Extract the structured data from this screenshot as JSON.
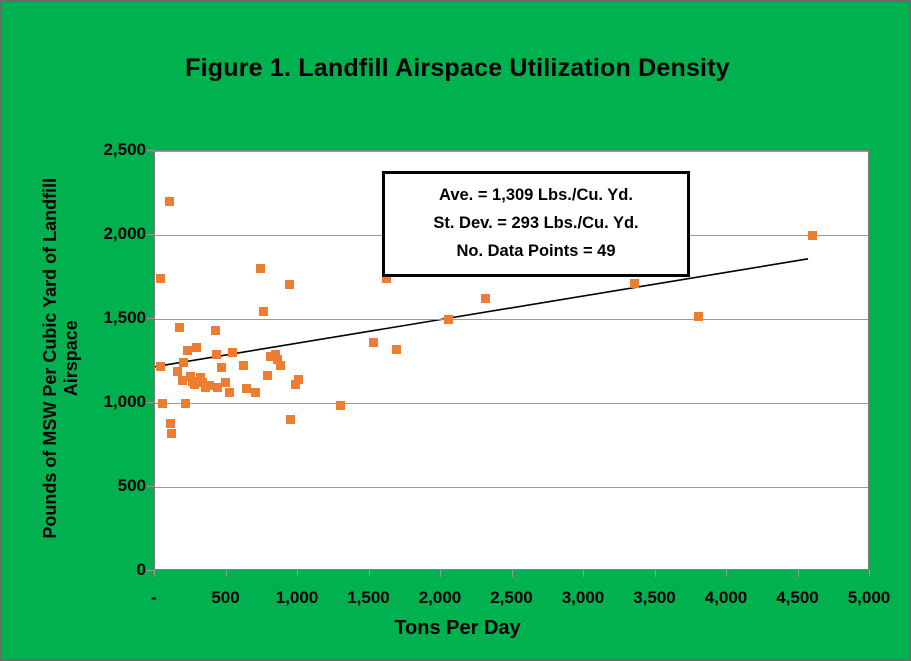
{
  "figure": {
    "background_color": "#00B14F",
    "border_color": "#6b6b6b",
    "title": "Figure 1. Landfill Airspace Utilization Density"
  },
  "axes": {
    "x_title": "Tons Per Day",
    "y_title_line1": "Pounds of MSW Per Cubic Yard of Landfill",
    "y_title_line2": "Airspace"
  },
  "annotation": {
    "line1": "Ave. = 1,309 Lbs./Cu. Yd.",
    "line2": "St. Dev. = 293 Lbs./Cu. Yd.",
    "line3": "No. Data Points = 49"
  },
  "chart_data": {
    "type": "scatter",
    "title": "Figure 1. Landfill Airspace Utilization Density",
    "xlabel": "Tons Per Day",
    "ylabel": "Pounds of MSW Per Cubic Yard of Landfill Airspace",
    "xlim": [
      0,
      5000
    ],
    "ylim": [
      0,
      2500
    ],
    "xticks": [
      0,
      500,
      1000,
      1500,
      2000,
      2500,
      3000,
      3500,
      4000,
      4500,
      5000
    ],
    "xticklabels": [
      "-",
      "500",
      "1,000",
      "1,500",
      "2,000",
      "2,500",
      "3,000",
      "3,500",
      "4,000",
      "4,500",
      "5,000"
    ],
    "yticks": [
      0,
      500,
      1000,
      1500,
      2000,
      2500
    ],
    "yticklabels": [
      "0",
      "500",
      "1,000",
      "1,500",
      "2,000",
      "2,500"
    ],
    "grid": "horizontal",
    "legend": "none",
    "marker_color": "#ED7D31",
    "marker_shape": "square",
    "n_points": 49,
    "mean_y": 1309,
    "std_y": 293,
    "series": [
      {
        "name": "Landfill airspace utilization density",
        "points": [
          [
            40,
            1740
          ],
          [
            40,
            1215
          ],
          [
            50,
            1000
          ],
          [
            100,
            2200
          ],
          [
            110,
            880
          ],
          [
            115,
            820
          ],
          [
            160,
            1190
          ],
          [
            170,
            1450
          ],
          [
            190,
            1135
          ],
          [
            200,
            1240
          ],
          [
            215,
            995
          ],
          [
            230,
            1310
          ],
          [
            250,
            1160
          ],
          [
            260,
            1130
          ],
          [
            275,
            1110
          ],
          [
            290,
            1330
          ],
          [
            320,
            1150
          ],
          [
            330,
            1125
          ],
          [
            355,
            1090
          ],
          [
            380,
            1105
          ],
          [
            420,
            1430
          ],
          [
            430,
            1290
          ],
          [
            440,
            1090
          ],
          [
            465,
            1210
          ],
          [
            490,
            1120
          ],
          [
            520,
            1060
          ],
          [
            545,
            1300
          ],
          [
            620,
            1225
          ],
          [
            640,
            1085
          ],
          [
            700,
            1060
          ],
          [
            740,
            1800
          ],
          [
            760,
            1545
          ],
          [
            790,
            1165
          ],
          [
            810,
            1275
          ],
          [
            840,
            1290
          ],
          [
            860,
            1260
          ],
          [
            880,
            1225
          ],
          [
            940,
            1705
          ],
          [
            950,
            900
          ],
          [
            980,
            1110
          ],
          [
            1005,
            1140
          ],
          [
            1300,
            985
          ],
          [
            1530,
            1360
          ],
          [
            1620,
            1740
          ],
          [
            1690,
            1320
          ],
          [
            2050,
            1500
          ],
          [
            2310,
            1620
          ],
          [
            3350,
            1710
          ],
          [
            3800,
            1515
          ],
          [
            4600,
            2000
          ]
        ]
      }
    ],
    "trendline": {
      "type": "linear",
      "color": "#000000",
      "x_start": 0,
      "y_start": 1210,
      "x_end": 4580,
      "y_end": 1855
    }
  }
}
